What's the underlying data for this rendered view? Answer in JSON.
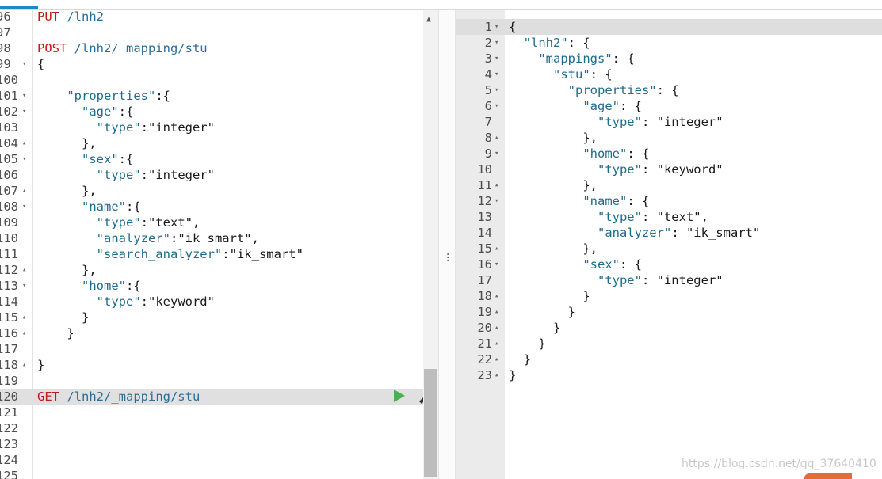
{
  "left_editor": {
    "lines": [
      {
        "num": "96",
        "fold": "",
        "parts": [
          {
            "t": "PUT",
            "c": "method"
          },
          {
            "t": " /lnh2",
            "c": "url"
          }
        ]
      },
      {
        "num": "97",
        "fold": "",
        "parts": []
      },
      {
        "num": "98",
        "fold": "",
        "parts": [
          {
            "t": "POST",
            "c": "method"
          },
          {
            "t": " /lnh2/_mapping/stu",
            "c": "url"
          }
        ]
      },
      {
        "num": "99",
        "fold": "▾",
        "parts": [
          {
            "t": "{",
            "c": "punc"
          }
        ]
      },
      {
        "num": "100",
        "fold": "",
        "parts": []
      },
      {
        "num": "101",
        "fold": "▾",
        "parts": [
          {
            "t": "    \"properties\"",
            "c": "key"
          },
          {
            "t": ":{",
            "c": "punc"
          }
        ]
      },
      {
        "num": "102",
        "fold": "▾",
        "parts": [
          {
            "t": "      \"age\"",
            "c": "key"
          },
          {
            "t": ":{",
            "c": "punc"
          }
        ]
      },
      {
        "num": "103",
        "fold": "",
        "parts": [
          {
            "t": "        \"type\"",
            "c": "key"
          },
          {
            "t": ":\"integer\"",
            "c": "str"
          }
        ]
      },
      {
        "num": "104",
        "fold": "▴",
        "parts": [
          {
            "t": "      },",
            "c": "punc"
          }
        ]
      },
      {
        "num": "105",
        "fold": "▾",
        "parts": [
          {
            "t": "      \"sex\"",
            "c": "key"
          },
          {
            "t": ":{",
            "c": "punc"
          }
        ]
      },
      {
        "num": "106",
        "fold": "",
        "parts": [
          {
            "t": "        \"type\"",
            "c": "key"
          },
          {
            "t": ":\"integer\"",
            "c": "str"
          }
        ]
      },
      {
        "num": "107",
        "fold": "▴",
        "parts": [
          {
            "t": "      },",
            "c": "punc"
          }
        ]
      },
      {
        "num": "108",
        "fold": "▾",
        "parts": [
          {
            "t": "      \"name\"",
            "c": "key"
          },
          {
            "t": ":{",
            "c": "punc"
          }
        ]
      },
      {
        "num": "109",
        "fold": "",
        "parts": [
          {
            "t": "        \"type\"",
            "c": "key"
          },
          {
            "t": ":\"text\",",
            "c": "str"
          }
        ]
      },
      {
        "num": "110",
        "fold": "",
        "parts": [
          {
            "t": "        \"analyzer\"",
            "c": "key"
          },
          {
            "t": ":\"ik_smart\",",
            "c": "str"
          }
        ]
      },
      {
        "num": "111",
        "fold": "",
        "parts": [
          {
            "t": "        \"search_analyzer\"",
            "c": "key"
          },
          {
            "t": ":\"ik_smart\"",
            "c": "str"
          }
        ]
      },
      {
        "num": "112",
        "fold": "▴",
        "parts": [
          {
            "t": "      },",
            "c": "punc"
          }
        ]
      },
      {
        "num": "113",
        "fold": "▾",
        "parts": [
          {
            "t": "      \"home\"",
            "c": "key"
          },
          {
            "t": ":{",
            "c": "punc"
          }
        ]
      },
      {
        "num": "114",
        "fold": "",
        "parts": [
          {
            "t": "        \"type\"",
            "c": "key"
          },
          {
            "t": ":\"keyword\"",
            "c": "str"
          }
        ]
      },
      {
        "num": "115",
        "fold": "▴",
        "parts": [
          {
            "t": "      }",
            "c": "punc"
          }
        ]
      },
      {
        "num": "116",
        "fold": "▴",
        "parts": [
          {
            "t": "    }",
            "c": "punc"
          }
        ]
      },
      {
        "num": "117",
        "fold": "",
        "parts": []
      },
      {
        "num": "118",
        "fold": "▴",
        "parts": [
          {
            "t": "}",
            "c": "punc"
          }
        ]
      },
      {
        "num": "119",
        "fold": "",
        "parts": []
      },
      {
        "num": "120",
        "fold": "",
        "active": true,
        "parts": [
          {
            "t": "GET",
            "c": "method"
          },
          {
            "t": " /lnh2/_mapping/stu",
            "c": "url"
          }
        ]
      },
      {
        "num": "121",
        "fold": "",
        "parts": []
      },
      {
        "num": "122",
        "fold": "",
        "parts": []
      },
      {
        "num": "123",
        "fold": "",
        "parts": []
      },
      {
        "num": "124",
        "fold": "",
        "parts": []
      },
      {
        "num": "125",
        "fold": "",
        "parts": []
      }
    ]
  },
  "right_output": {
    "lines": [
      {
        "num": "1",
        "fold": "▾",
        "active": true,
        "parts": [
          {
            "t": "{",
            "c": "punc"
          }
        ]
      },
      {
        "num": "2",
        "fold": "▾",
        "parts": [
          {
            "t": "  \"lnh2\"",
            "c": "key"
          },
          {
            "t": ": {",
            "c": "punc"
          }
        ]
      },
      {
        "num": "3",
        "fold": "▾",
        "parts": [
          {
            "t": "    \"mappings\"",
            "c": "key"
          },
          {
            "t": ": {",
            "c": "punc"
          }
        ]
      },
      {
        "num": "4",
        "fold": "▾",
        "parts": [
          {
            "t": "      \"stu\"",
            "c": "key"
          },
          {
            "t": ": {",
            "c": "punc"
          }
        ]
      },
      {
        "num": "5",
        "fold": "▾",
        "parts": [
          {
            "t": "        \"properties\"",
            "c": "key"
          },
          {
            "t": ": {",
            "c": "punc"
          }
        ]
      },
      {
        "num": "6",
        "fold": "▾",
        "parts": [
          {
            "t": "          \"age\"",
            "c": "key"
          },
          {
            "t": ": {",
            "c": "punc"
          }
        ]
      },
      {
        "num": "7",
        "fold": "",
        "parts": [
          {
            "t": "            \"type\"",
            "c": "key"
          },
          {
            "t": ": \"integer\"",
            "c": "str"
          }
        ]
      },
      {
        "num": "8",
        "fold": "▴",
        "parts": [
          {
            "t": "          },",
            "c": "punc"
          }
        ]
      },
      {
        "num": "9",
        "fold": "▾",
        "parts": [
          {
            "t": "          \"home\"",
            "c": "key"
          },
          {
            "t": ": {",
            "c": "punc"
          }
        ]
      },
      {
        "num": "10",
        "fold": "",
        "parts": [
          {
            "t": "            \"type\"",
            "c": "key"
          },
          {
            "t": ": \"keyword\"",
            "c": "str"
          }
        ]
      },
      {
        "num": "11",
        "fold": "▴",
        "parts": [
          {
            "t": "          },",
            "c": "punc"
          }
        ]
      },
      {
        "num": "12",
        "fold": "▾",
        "parts": [
          {
            "t": "          \"name\"",
            "c": "key"
          },
          {
            "t": ": {",
            "c": "punc"
          }
        ]
      },
      {
        "num": "13",
        "fold": "",
        "parts": [
          {
            "t": "            \"type\"",
            "c": "key"
          },
          {
            "t": ": \"text\",",
            "c": "str"
          }
        ]
      },
      {
        "num": "14",
        "fold": "",
        "parts": [
          {
            "t": "            \"analyzer\"",
            "c": "key"
          },
          {
            "t": ": \"ik_smart\"",
            "c": "str"
          }
        ]
      },
      {
        "num": "15",
        "fold": "▴",
        "parts": [
          {
            "t": "          },",
            "c": "punc"
          }
        ]
      },
      {
        "num": "16",
        "fold": "▾",
        "parts": [
          {
            "t": "          \"sex\"",
            "c": "key"
          },
          {
            "t": ": {",
            "c": "punc"
          }
        ]
      },
      {
        "num": "17",
        "fold": "",
        "parts": [
          {
            "t": "            \"type\"",
            "c": "key"
          },
          {
            "t": ": \"integer\"",
            "c": "str"
          }
        ]
      },
      {
        "num": "18",
        "fold": "▴",
        "parts": [
          {
            "t": "          }",
            "c": "punc"
          }
        ]
      },
      {
        "num": "19",
        "fold": "▴",
        "parts": [
          {
            "t": "        }",
            "c": "punc"
          }
        ]
      },
      {
        "num": "20",
        "fold": "▴",
        "parts": [
          {
            "t": "      }",
            "c": "punc"
          }
        ]
      },
      {
        "num": "21",
        "fold": "▴",
        "parts": [
          {
            "t": "    }",
            "c": "punc"
          }
        ]
      },
      {
        "num": "22",
        "fold": "▴",
        "parts": [
          {
            "t": "  }",
            "c": "punc"
          }
        ]
      },
      {
        "num": "23",
        "fold": "▴",
        "parts": [
          {
            "t": "}",
            "c": "punc"
          }
        ]
      }
    ]
  },
  "icons": {
    "play": "play-icon",
    "wrench": "wrench-icon",
    "scroll_up": "chevron-up-icon",
    "splitter": "drag-handle-icon"
  },
  "colors": {
    "method": "#c41a16",
    "url": "#2a6e95",
    "key": "#1f6b8c",
    "play": "#4caf50",
    "accent": "#1f88c8"
  },
  "watermark": "https://blog.csdn.net/qq_37640410"
}
